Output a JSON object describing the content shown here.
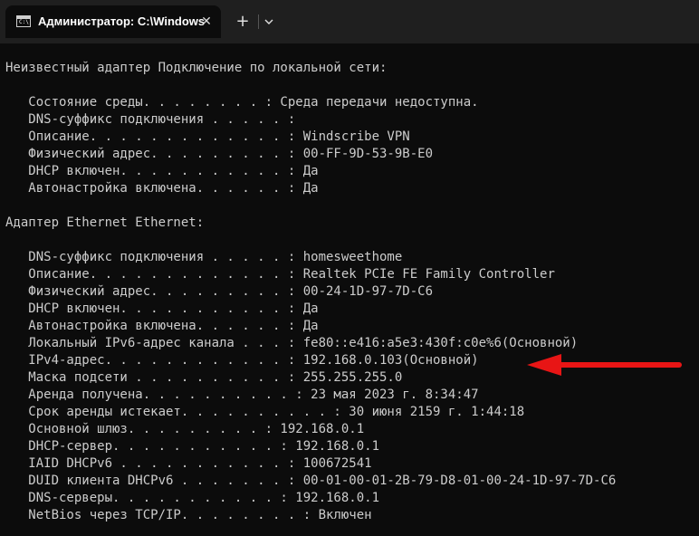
{
  "window": {
    "tab_title": "Администратор: C:\\Windows",
    "tab_icon_glyph": "C:\\",
    "close_glyph": "✕",
    "new_tab_glyph": "+"
  },
  "terminal": {
    "lines": [
      "Неизвестный адаптер Подключение по локальной сети:",
      "",
      "   Состояние среды. . . . . . . . : Среда передачи недоступна.",
      "   DNS-суффикс подключения . . . . . :",
      "   Описание. . . . . . . . . . . . . : Windscribe VPN",
      "   Физический адрес. . . . . . . . . : 00-FF-9D-53-9B-E0",
      "   DHCP включен. . . . . . . . . . . : Да",
      "   Автонастройка включена. . . . . . : Да",
      "",
      "Адаптер Ethernet Ethernet:",
      "",
      "   DNS-суффикс подключения . . . . . : homesweethome",
      "   Описание. . . . . . . . . . . . . : Realtek PCIe FE Family Controller",
      "   Физический адрес. . . . . . . . . : 00-24-1D-97-7D-C6",
      "   DHCP включен. . . . . . . . . . . : Да",
      "   Автонастройка включена. . . . . . : Да",
      "   Локальный IPv6-адрес канала . . . : fe80::e416:a5e3:430f:c0e%6(Основной)",
      "   IPv4-адрес. . . . . . . . . . . . : 192.168.0.103(Основной)",
      "   Маска подсети . . . . . . . . . . : 255.255.255.0",
      "   Аренда получена. . . . . . . . . . : 23 мая 2023 г. 8:34:47",
      "   Срок аренды истекает. . . . . . . . . . : 30 июня 2159 г. 1:44:18",
      "   Основной шлюз. . . . . . . . . : 192.168.0.1",
      "   DHCP-сервер. . . . . . . . . . . : 192.168.0.1",
      "   IAID DHCPv6 . . . . . . . . . . . : 100672541",
      "   DUID клиента DHCPv6 . . . . . . . : 00-01-00-01-2B-79-D8-01-00-24-1D-97-7D-C6",
      "   DNS-серверы. . . . . . . . . . . : 192.168.0.1",
      "   NetBios через TCP/IP. . . . . . . . : Включен"
    ]
  },
  "annotation": {
    "arrow_color": "#e81515",
    "points_to": "IPv4-адрес"
  },
  "colors": {
    "terminal_bg": "#0c0c0c",
    "terminal_text": "#cccccc",
    "titlebar_bg": "#1f1f1f"
  }
}
